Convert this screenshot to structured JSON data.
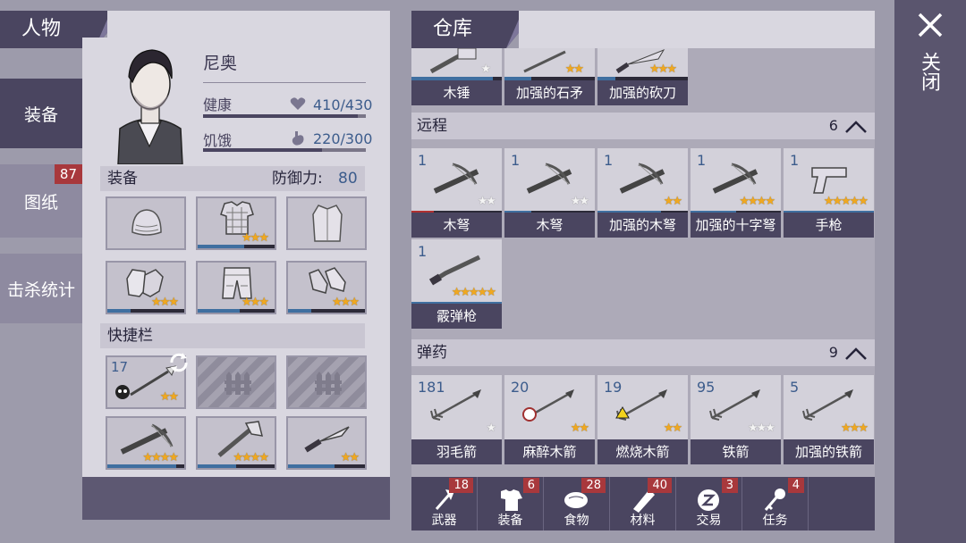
{
  "character_panel": {
    "title": "人物",
    "name": "尼奥",
    "health_label": "健康",
    "health_value": "410/430",
    "health_fraction": 0.95,
    "hunger_label": "饥饿",
    "hunger_value": "220/300",
    "hunger_fraction": 0.73
  },
  "side_tabs": [
    {
      "label": "装备",
      "active": true
    },
    {
      "label": "图纸",
      "badge": "87"
    },
    {
      "label": "击杀统计"
    }
  ],
  "equipment": {
    "title": "装备",
    "defense_label": "防御力:",
    "defense_value": "80",
    "slots": [
      {
        "icon": "helmet-icon",
        "stars": ""
      },
      {
        "icon": "chest-armor-icon",
        "stars": "★★★",
        "durability": 0.6
      },
      {
        "icon": "jacket-icon",
        "stars": ""
      },
      {
        "icon": "gloves-icon",
        "stars": "★★★",
        "durability": 0.3
      },
      {
        "icon": "pants-icon",
        "stars": "★★★",
        "durability": 0.55
      },
      {
        "icon": "boots-icon",
        "stars": "★★★",
        "durability": 0.3
      }
    ]
  },
  "quickbar": {
    "title": "快捷栏",
    "slots": [
      {
        "icon": "spear-icon",
        "count": "17",
        "stars": "★★"
      },
      {
        "icon": "fence-icon",
        "locked": true
      },
      {
        "icon": "fence-icon",
        "locked": true
      },
      {
        "icon": "crossbow-icon",
        "stars": "★★★★",
        "durability": 0.9
      },
      {
        "icon": "axe-icon",
        "stars": "★★★★",
        "durability": 0.5
      },
      {
        "icon": "knife-icon",
        "stars": "★★",
        "durability": 0.6
      }
    ]
  },
  "storage": {
    "title": "仓库",
    "top_row": [
      {
        "label": "木锤",
        "stars": "★",
        "durability": 0.9
      },
      {
        "label": "加强的石矛",
        "stars": "★★",
        "durability": 0.3
      },
      {
        "label": "加强的砍刀",
        "stars": "★★★",
        "durability": 0.2
      }
    ],
    "ranged": {
      "title": "远程",
      "count": "6",
      "items": [
        {
          "label": "木弩",
          "count": "1",
          "stars": "★★",
          "durability": 0.25,
          "bar_color": "#b03030"
        },
        {
          "label": "木弩",
          "count": "1",
          "stars": "★★",
          "durability": 0.3
        },
        {
          "label": "加强的木弩",
          "count": "1",
          "stars": "★★",
          "durability": 0.7
        },
        {
          "label": "加强的十字弩",
          "count": "1",
          "stars": "★★★★",
          "durability": 0.5
        },
        {
          "label": "手枪",
          "count": "1",
          "stars": "★★★★★",
          "durability": 1.0
        },
        {
          "label": "霰弹枪",
          "count": "1",
          "stars": "★★★★★",
          "durability": 1.0
        }
      ]
    },
    "ammo": {
      "title": "弹药",
      "count": "9",
      "items": [
        {
          "label": "羽毛箭",
          "count": "181",
          "stars": "★"
        },
        {
          "label": "麻醉木箭",
          "count": "20",
          "stars": "★★"
        },
        {
          "label": "燃烧木箭",
          "count": "19",
          "stars": "★★"
        },
        {
          "label": "铁箭",
          "count": "95",
          "stars": "★★★"
        },
        {
          "label": "加强的铁箭",
          "count": "5",
          "stars": "★★★"
        }
      ]
    }
  },
  "bottom_tabs": [
    {
      "label": "武器",
      "badge": "18",
      "icon": "axe-icon"
    },
    {
      "label": "装备",
      "badge": "6",
      "icon": "shirt-icon"
    },
    {
      "label": "食物",
      "badge": "28",
      "icon": "meat-icon"
    },
    {
      "label": "材料",
      "badge": "40",
      "icon": "log-icon"
    },
    {
      "label": "交易",
      "badge": "3",
      "icon": "coin-icon"
    },
    {
      "label": "任务",
      "badge": "4",
      "icon": "key-icon"
    }
  ],
  "close_label": "关闭"
}
